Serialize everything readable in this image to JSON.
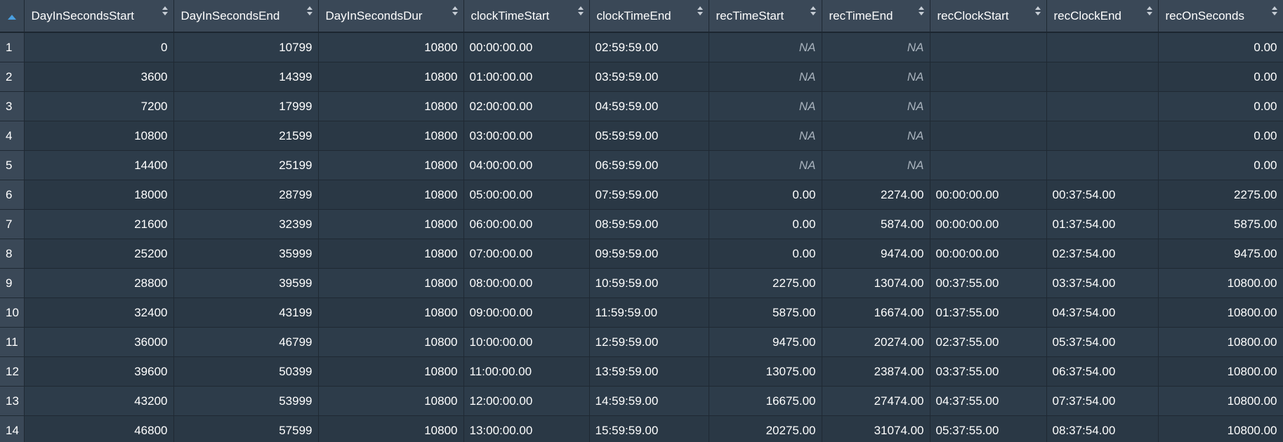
{
  "table": {
    "columns": [
      {
        "key": "DayInSecondsStart",
        "label": "DayInSecondsStart",
        "align": "num"
      },
      {
        "key": "DayInSecondsEnd",
        "label": "DayInSecondsEnd",
        "align": "num"
      },
      {
        "key": "DayInSecondsDur",
        "label": "DayInSecondsDur",
        "align": "num"
      },
      {
        "key": "clockTimeStart",
        "label": "clockTimeStart",
        "align": "txt"
      },
      {
        "key": "clockTimeEnd",
        "label": "clockTimeEnd",
        "align": "txt"
      },
      {
        "key": "recTimeStart",
        "label": "recTimeStart",
        "align": "num"
      },
      {
        "key": "recTimeEnd",
        "label": "recTimeEnd",
        "align": "num"
      },
      {
        "key": "recClockStart",
        "label": "recClockStart",
        "align": "txt"
      },
      {
        "key": "recClockEnd",
        "label": "recClockEnd",
        "align": "txt"
      },
      {
        "key": "recOnSeconds",
        "label": "recOnSeconds",
        "align": "num"
      }
    ],
    "rows": [
      {
        "index": "1",
        "cells": [
          "0",
          "10799",
          "10800",
          "00:00:00.00",
          "02:59:59.00",
          "NA",
          "NA",
          "",
          "",
          "0.00"
        ]
      },
      {
        "index": "2",
        "cells": [
          "3600",
          "14399",
          "10800",
          "01:00:00.00",
          "03:59:59.00",
          "NA",
          "NA",
          "",
          "",
          "0.00"
        ]
      },
      {
        "index": "3",
        "cells": [
          "7200",
          "17999",
          "10800",
          "02:00:00.00",
          "04:59:59.00",
          "NA",
          "NA",
          "",
          "",
          "0.00"
        ]
      },
      {
        "index": "4",
        "cells": [
          "10800",
          "21599",
          "10800",
          "03:00:00.00",
          "05:59:59.00",
          "NA",
          "NA",
          "",
          "",
          "0.00"
        ]
      },
      {
        "index": "5",
        "cells": [
          "14400",
          "25199",
          "10800",
          "04:00:00.00",
          "06:59:59.00",
          "NA",
          "NA",
          "",
          "",
          "0.00"
        ]
      },
      {
        "index": "6",
        "cells": [
          "18000",
          "28799",
          "10800",
          "05:00:00.00",
          "07:59:59.00",
          "0.00",
          "2274.00",
          "00:00:00.00",
          "00:37:54.00",
          "2275.00"
        ]
      },
      {
        "index": "7",
        "cells": [
          "21600",
          "32399",
          "10800",
          "06:00:00.00",
          "08:59:59.00",
          "0.00",
          "5874.00",
          "00:00:00.00",
          "01:37:54.00",
          "5875.00"
        ]
      },
      {
        "index": "8",
        "cells": [
          "25200",
          "35999",
          "10800",
          "07:00:00.00",
          "09:59:59.00",
          "0.00",
          "9474.00",
          "00:00:00.00",
          "02:37:54.00",
          "9475.00"
        ]
      },
      {
        "index": "9",
        "cells": [
          "28800",
          "39599",
          "10800",
          "08:00:00.00",
          "10:59:59.00",
          "2275.00",
          "13074.00",
          "00:37:55.00",
          "03:37:54.00",
          "10800.00"
        ]
      },
      {
        "index": "10",
        "cells": [
          "32400",
          "43199",
          "10800",
          "09:00:00.00",
          "11:59:59.00",
          "5875.00",
          "16674.00",
          "01:37:55.00",
          "04:37:54.00",
          "10800.00"
        ]
      },
      {
        "index": "11",
        "cells": [
          "36000",
          "46799",
          "10800",
          "10:00:00.00",
          "12:59:59.00",
          "9475.00",
          "20274.00",
          "02:37:55.00",
          "05:37:54.00",
          "10800.00"
        ]
      },
      {
        "index": "12",
        "cells": [
          "39600",
          "50399",
          "10800",
          "11:00:00.00",
          "13:59:59.00",
          "13075.00",
          "23874.00",
          "03:37:55.00",
          "06:37:54.00",
          "10800.00"
        ]
      },
      {
        "index": "13",
        "cells": [
          "43200",
          "53999",
          "10800",
          "12:00:00.00",
          "14:59:59.00",
          "16675.00",
          "27474.00",
          "04:37:55.00",
          "07:37:54.00",
          "10800.00"
        ]
      },
      {
        "index": "14",
        "cells": [
          "46800",
          "57599",
          "10800",
          "13:00:00.00",
          "15:59:59.00",
          "20275.00",
          "31074.00",
          "05:37:55.00",
          "08:37:54.00",
          "10800.00"
        ]
      }
    ]
  }
}
